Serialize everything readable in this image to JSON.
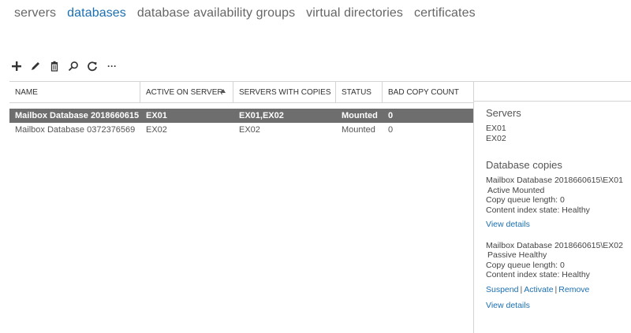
{
  "tabs": [
    {
      "label": "servers"
    },
    {
      "label": "databases"
    },
    {
      "label": "database availability groups"
    },
    {
      "label": "virtual directories"
    },
    {
      "label": "certificates"
    }
  ],
  "toolbar": {
    "icons": [
      "add-icon",
      "edit-icon",
      "delete-icon",
      "search-icon",
      "refresh-icon",
      "more-icon"
    ],
    "more_label": "···"
  },
  "grid": {
    "columns": [
      "NAME",
      "ACTIVE ON SERVER",
      "SERVERS WITH COPIES",
      "STATUS",
      "BAD COPY COUNT"
    ],
    "sort_column": "ACTIVE ON SERVER",
    "rows": [
      {
        "name": "Mailbox Database 2018660615",
        "active": "EX01",
        "copies": "EX01,EX02",
        "status": "Mounted",
        "bad": "0",
        "selected": true
      },
      {
        "name": "Mailbox Database 0372376569",
        "active": "EX02",
        "copies": "EX02",
        "status": "Mounted",
        "bad": "0",
        "selected": false
      }
    ]
  },
  "details": {
    "servers_title": "Servers",
    "servers": [
      "EX01",
      "EX02"
    ],
    "copies_title": "Database copies",
    "copy1": {
      "name": "Mailbox Database 2018660615\\EX01",
      "state": "Active Mounted",
      "queue": "Copy queue length: 0",
      "index": "Content index state: Healthy",
      "view": "View details"
    },
    "copy2": {
      "name": "Mailbox Database 2018660615\\EX02",
      "state": "Passive Healthy",
      "queue": "Copy queue length: 0",
      "index": "Content index state: Healthy",
      "suspend": "Suspend",
      "activate": "Activate",
      "remove": "Remove",
      "sep": "|",
      "view": "View details"
    }
  },
  "colors": {
    "accent": "#1a6fb3",
    "selected_row": "#6e6e6e"
  }
}
